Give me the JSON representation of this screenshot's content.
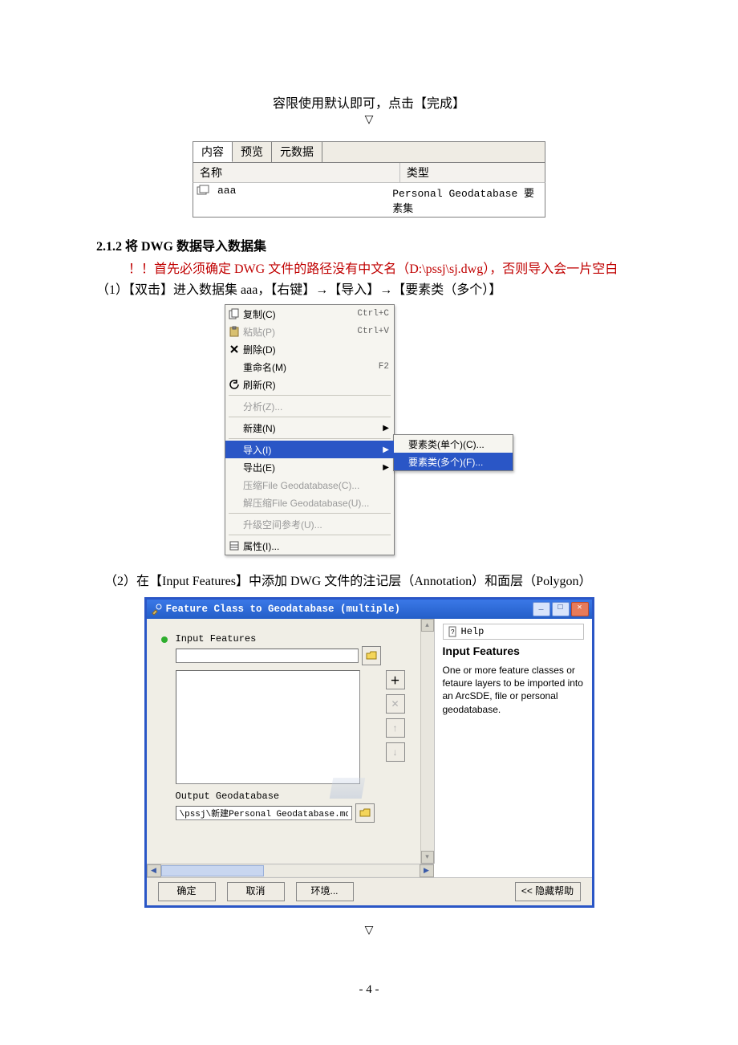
{
  "instruction_top": "容限使用默认即可，点击【完成】",
  "arrow": "▽",
  "tablefig": {
    "tabs": [
      "内容",
      "预览",
      "元数据"
    ],
    "col_name": "名称",
    "col_type": "类型",
    "row_name": "aaa",
    "row_type": "Personal Geodatabase 要素集"
  },
  "section_2_1_2": "2.1.2 将 DWG 数据导入数据集",
  "red_note": "！！首先必须确定 DWG 文件的路径没有中文名（D:\\pssj\\sj.dwg），否则导入会一片空白",
  "step1": "（1）【双击】进入数据集 aaa，【右键】→【导入】→【要素类（多个）】",
  "step2": "（2）在【Input Features】中添加 DWG 文件的注记层（Annotation）和面层（Polygon）",
  "context_menu": {
    "items": [
      {
        "icon": "copy-icon",
        "label": "复制(C)",
        "shortcut": "Ctrl+C",
        "disabled": false
      },
      {
        "icon": "paste-icon",
        "label": "粘贴(P)",
        "shortcut": "Ctrl+V",
        "disabled": true
      },
      {
        "icon": "delete-icon",
        "label": "删除(D)",
        "shortcut": "",
        "disabled": false
      },
      {
        "icon": "",
        "label": "重命名(M)",
        "shortcut": "F2",
        "disabled": false
      },
      {
        "icon": "refresh-icon",
        "label": "刷新(R)",
        "shortcut": "",
        "disabled": false
      },
      {
        "icon": "",
        "label": "分析(Z)...",
        "shortcut": "",
        "disabled": true,
        "sep_before": true
      },
      {
        "icon": "",
        "label": "新建(N)",
        "shortcut": "",
        "disabled": false,
        "arrow": true,
        "sep_before": true
      },
      {
        "icon": "",
        "label": "导入(I)",
        "shortcut": "",
        "disabled": false,
        "arrow": true,
        "highlight": true,
        "sep_before": true
      },
      {
        "icon": "",
        "label": "导出(E)",
        "shortcut": "",
        "disabled": false,
        "arrow": true
      },
      {
        "icon": "",
        "label": "压缩File Geodatabase(C)...",
        "disabled": true
      },
      {
        "icon": "",
        "label": "解压缩File Geodatabase(U)...",
        "disabled": true
      },
      {
        "icon": "",
        "label": "升级空间参考(U)...",
        "disabled": true,
        "sep_before": true
      },
      {
        "icon": "props-icon",
        "label": "属性(I)...",
        "shortcut": "",
        "disabled": false,
        "sep_before": true
      }
    ],
    "submenu": [
      {
        "label": "要素类(单个)(C)...",
        "highlight": false
      },
      {
        "label": "要素类(多个)(F)...",
        "highlight": true
      }
    ]
  },
  "dialog": {
    "title": "Feature Class to Geodatabase (multiple)",
    "input_features_label": "Input Features",
    "output_label": "Output Geodatabase",
    "output_value": "\\pssj\\新建Personal Geodatabase.mdb\\aaa",
    "help_label": "Help",
    "help_heading": "Input Features",
    "help_body": "One or more feature classes or fetaure layers to be imported into an ArcSDE, file or personal geodatabase.",
    "buttons": {
      "ok": "确定",
      "cancel": "取消",
      "env": "环境...",
      "hide": "<< 隐藏帮助"
    }
  },
  "page_number": "- 4 -"
}
